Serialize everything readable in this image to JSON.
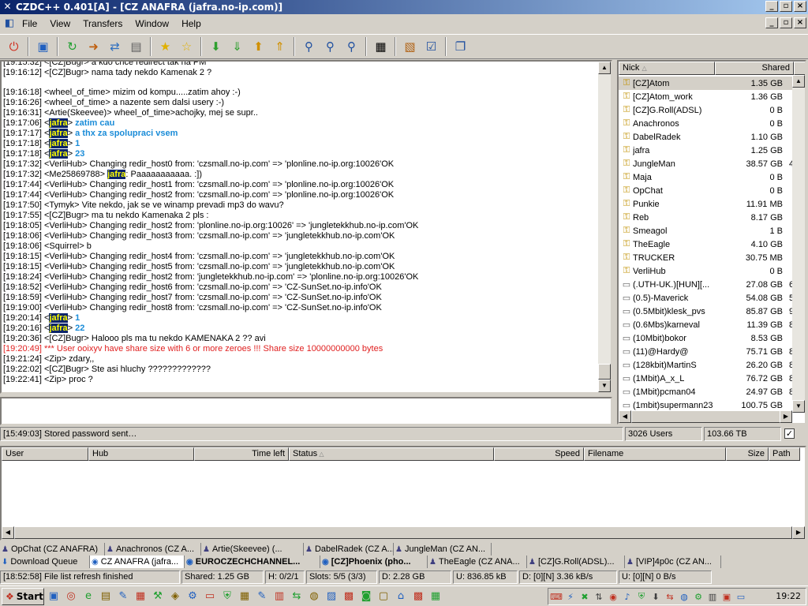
{
  "window": {
    "title": "CZDC++ 0.401[A] - [CZ ANAFRA (jafra.no-ip.com)]"
  },
  "menu": [
    "File",
    "View",
    "Transfers",
    "Window",
    "Help"
  ],
  "toolbar_icons": [
    "reconnect-icon",
    "favorite-hubs-icon",
    "refresh-icon",
    "follow-redirect-icon",
    "public-hubs-icon",
    "notepad-icon",
    "favorite-icon",
    "favorite-users-icon",
    "download-queue-icon",
    "finished-downloads-icon",
    "upload-queue-icon",
    "finished-uploads-icon",
    "search-icon",
    "adl-search-icon",
    "search-spy-icon",
    "network-stats-icon",
    "open-file-list-icon",
    "settings-icon",
    "cascade-icon"
  ],
  "chat": {
    "lines": [
      {
        "t": "[19:15:32] <[CZ]Bugr> a kdo chce redirect tak na PM"
      },
      {
        "t": "[19:16:12] <[CZ]Bugr> nama tady nekdo Kamenak 2 ?"
      },
      {
        "t": ""
      },
      {
        "t": "[19:16:18] <wheel_of_time> mizim od kompu.....zatim ahoy :-)"
      },
      {
        "t": "[19:16:26] <wheel_of_time> a nazente sem dalsi usery :-)"
      },
      {
        "t": "[19:16:31] <Artie(Skeevee)> wheel_of_time>achojky, mej se supr.."
      },
      {
        "ts": "[19:17:06] ",
        "nick": "jafra",
        "msg": "zatim cau"
      },
      {
        "ts": "[19:17:17] ",
        "nick": "jafra",
        "msg": "a thx za spolupraci vsem"
      },
      {
        "ts": "[19:17:18] ",
        "nick": "jafra",
        "msg": "1"
      },
      {
        "ts": "[19:17:18] ",
        "nick": "jafra",
        "msg": "23"
      },
      {
        "t": "[19:17:32] <VerliHub> Changing redir_host0 from: 'czsmall.no-ip.com' => 'plonline.no-ip.org:10026'OK"
      },
      {
        "ts": "[19:17:32] <Me25869788> ",
        "hl": "jafra",
        "msg": ": Paaaaaaaaaaa. :])"
      },
      {
        "t": "[19:17:44] <VerliHub> Changing redir_host1 from: 'czsmall.no-ip.com' => 'plonline.no-ip.org:10026'OK"
      },
      {
        "t": "[19:17:44] <VerliHub> Changing redir_host2 from: 'czsmall.no-ip.com' => 'plonline.no-ip.org:10026'OK"
      },
      {
        "t": "[19:17:50] <Tymyk> Vite nekdo, jak se ve winamp prevadi mp3 do wavu?"
      },
      {
        "t": "[19:17:55] <[CZ]Bugr> ma tu nekdo Kamenaka 2 pls :"
      },
      {
        "t": "[19:18:05] <VerliHub> Changing redir_host2 from: 'plonline.no-ip.org:10026' => 'jungletekkhub.no-ip.com'OK"
      },
      {
        "t": "[19:18:06] <VerliHub> Changing redir_host3 from: 'czsmall.no-ip.com' => 'jungletekkhub.no-ip.com'OK"
      },
      {
        "t": "[19:18:06] <Squirrel> b"
      },
      {
        "t": "[19:18:15] <VerliHub> Changing redir_host4 from: 'czsmall.no-ip.com' => 'jungletekkhub.no-ip.com'OK"
      },
      {
        "t": "[19:18:15] <VerliHub> Changing redir_host5 from: 'czsmall.no-ip.com' => 'jungletekkhub.no-ip.com'OK"
      },
      {
        "t": "[19:18:24] <VerliHub> Changing redir_host2 from: 'jungletekkhub.no-ip.com' => 'plonline.no-ip.org:10026'OK"
      },
      {
        "t": "[19:18:52] <VerliHub> Changing redir_host6 from: 'czsmall.no-ip.com' => 'CZ-SunSet.no-ip.info'OK"
      },
      {
        "t": "[19:18:59] <VerliHub> Changing redir_host7 from: 'czsmall.no-ip.com' => 'CZ-SunSet.no-ip.info'OK"
      },
      {
        "t": "[19:19:00] <VerliHub> Changing redir_host8 from: 'czsmall.no-ip.com' => 'CZ-SunSet.no-ip.info'OK"
      },
      {
        "ts": "[19:20:14] ",
        "nick": "jafra",
        "msg": "1"
      },
      {
        "ts": "[19:20:16] ",
        "nick": "jafra",
        "msg": "22"
      },
      {
        "t": "[19:20:36] <[CZ]Bugr> Halooo pls ma tu nekdo KAMENAKA 2 ?? avi"
      },
      {
        "t": "[19:20:49] *** User ooixyv have share size with 6 or more zeroes !!! Share size 10000000000 bytes",
        "red": true
      },
      {
        "t": "[19:21:24] <Zip> zdary,,"
      },
      {
        "t": "[19:22:02] <[CZ]Bugr> Ste asi hluchy ?????????????"
      },
      {
        "t": "[19:22:41] <Zip> proc ?"
      }
    ]
  },
  "userlist": {
    "col_nick": "Nick",
    "col_shared": "Shared",
    "users": [
      {
        "nick": "[CZ]Atom",
        "shared": "1.35 GB",
        "icon": "op-key-icon",
        "extra": ""
      },
      {
        "nick": "[CZ]Atom_work",
        "shared": "1.36 GB",
        "icon": "op-key-icon",
        "extra": ""
      },
      {
        "nick": "[CZ]G.Roll(ADSL)",
        "shared": "0 B",
        "icon": "op-key-icon",
        "extra": ""
      },
      {
        "nick": "Anachronos",
        "shared": "0 B",
        "icon": "op-key-icon",
        "extra": ""
      },
      {
        "nick": "DabelRadek",
        "shared": "1.10 GB",
        "icon": "op-key-icon",
        "extra": ""
      },
      {
        "nick": "jafra",
        "shared": "1.25 GB",
        "icon": "op-key-icon",
        "extra": ""
      },
      {
        "nick": "JungleMan",
        "shared": "38.57 GB",
        "icon": "op-key-icon",
        "extra": "4"
      },
      {
        "nick": "Maja",
        "shared": "0 B",
        "icon": "op-key-icon",
        "extra": ""
      },
      {
        "nick": "OpChat",
        "shared": "0 B",
        "icon": "op-key-icon",
        "extra": ""
      },
      {
        "nick": "Punkie",
        "shared": "11.91 MB",
        "icon": "op-key-icon",
        "extra": ""
      },
      {
        "nick": "Reb",
        "shared": "8.17 GB",
        "icon": "op-key-icon",
        "extra": ""
      },
      {
        "nick": "Smeagol",
        "shared": "1 B",
        "icon": "op-key-icon",
        "extra": ""
      },
      {
        "nick": "TheEagle",
        "shared": "4.10 GB",
        "icon": "op-key-icon",
        "extra": ""
      },
      {
        "nick": "TRUCKER",
        "shared": "30.75 MB",
        "icon": "op-key-icon",
        "extra": ""
      },
      {
        "nick": "VerliHub",
        "shared": "0 B",
        "icon": "op-key-icon",
        "extra": ""
      },
      {
        "nick": "(.UTH-UK.)[HUN][...",
        "shared": "27.08 GB",
        "icon": "user-icon",
        "extra": "6"
      },
      {
        "nick": "(0.5)-Maverick",
        "shared": "54.08 GB",
        "icon": "user-icon",
        "extra": "5"
      },
      {
        "nick": "(0.5Mbit)klesk_pvs",
        "shared": "85.87 GB",
        "icon": "user-icon",
        "extra": "9"
      },
      {
        "nick": "(0.6Mbs)karneval",
        "shared": "11.39 GB",
        "icon": "user-icon",
        "extra": "8"
      },
      {
        "nick": "(10Mbit)bokor",
        "shared": "8.53 GB",
        "icon": "user-icon",
        "extra": ""
      },
      {
        "nick": "(11)@Hardy@",
        "shared": "75.71 GB",
        "icon": "user-icon",
        "extra": "8"
      },
      {
        "nick": "(128kbit)MartinS",
        "shared": "26.20 GB",
        "icon": "user-icon",
        "extra": "8"
      },
      {
        "nick": "(1Mbit)A_x_L",
        "shared": "76.72 GB",
        "icon": "user-icon",
        "extra": "8"
      },
      {
        "nick": "(1Mbit)pcman04",
        "shared": "24.97 GB",
        "icon": "user-icon",
        "extra": "8"
      },
      {
        "nick": "(1mbit)supermann23",
        "shared": "100.75 GB",
        "icon": "user-icon",
        "extra": ""
      }
    ]
  },
  "hub_status": {
    "message": "[15:49:03] Stored password sent…",
    "users": "3026 Users",
    "total_shared": "103.66 TB",
    "checkbox": "✓"
  },
  "transfers": {
    "columns": [
      "User",
      "Hub",
      "Time left",
      "Status",
      "Speed",
      "Filename",
      "Size",
      "Path"
    ]
  },
  "window_tabs_row1": [
    {
      "label": "OpChat (CZ ANAFRA)",
      "icon": "user-icon"
    },
    {
      "label": "Anachronos (CZ A...",
      "icon": "user-icon"
    },
    {
      "label": "Artie(Skeevee) (...",
      "icon": "user-icon"
    },
    {
      "label": "DabelRadek (CZ A...",
      "icon": "user-icon"
    },
    {
      "label": "JungleMan (CZ AN...",
      "icon": "user-icon"
    }
  ],
  "window_tabs_row2": [
    {
      "label": "Download Queue",
      "icon": "download-queue-icon"
    },
    {
      "label": "CZ ANAFRA (jafra...",
      "icon": "hub-icon"
    },
    {
      "label": "EUROCZECHCHANNEL...",
      "icon": "hub-icon",
      "bold": true
    },
    {
      "label": "[CZ]Phoenix (pho...",
      "icon": "hub-icon",
      "bold": true
    },
    {
      "label": "TheEagle (CZ ANA...",
      "icon": "user-icon"
    },
    {
      "label": "[CZ]G.Roll(ADSL)...",
      "icon": "user-icon"
    },
    {
      "label": "[VIP]4p0c (CZ AN...",
      "icon": "user-icon"
    }
  ],
  "status_bar": {
    "message": "[18:52:58] File list refresh finished",
    "shared": "Shared: 1.25 GB",
    "hubs": "H: 0/2/1",
    "slots": "Slots: 5/5 (3/3)",
    "downloaded": "D: 2.28 GB",
    "uploaded": "U: 836.85 kB",
    "down_speed": "D: [0][N] 3.36 kB/s",
    "up_speed": "U: [0][N] 0 B/s"
  },
  "taskbar": {
    "start_label": "Start",
    "clock": "19:22"
  }
}
